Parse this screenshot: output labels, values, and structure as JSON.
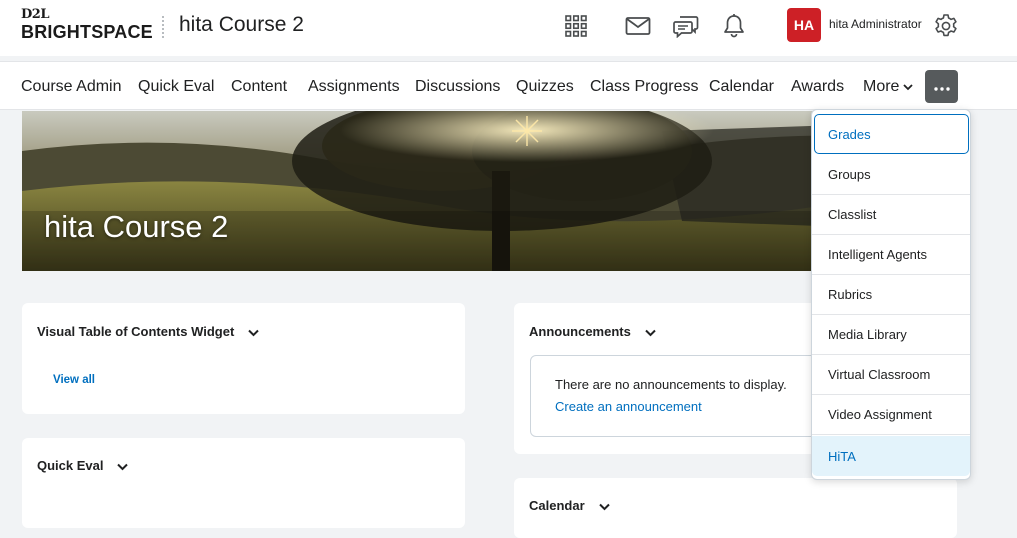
{
  "header": {
    "logo_top": "D2L",
    "logo_bottom": "BRIGHTSPACE",
    "course_title": "hita Course 2",
    "avatar_initials": "HA",
    "user_name": "hita Administrator",
    "avatar_color": "#cd2026"
  },
  "nav": {
    "items": [
      "Course Admin",
      "Quick Eval",
      "Content",
      "Assignments",
      "Discussions",
      "Quizzes",
      "Class Progress",
      "Calendar",
      "Awards"
    ],
    "more_label": "More"
  },
  "banner": {
    "title": "hita Course 2"
  },
  "widgets": {
    "toc": {
      "title": "Visual Table of Contents Widget",
      "link": "View all"
    },
    "quick_eval": {
      "title": "Quick Eval"
    },
    "announcements": {
      "title": "Announcements",
      "empty_text": "There are no announcements to display.",
      "create_link": "Create an announcement"
    },
    "calendar": {
      "title": "Calendar"
    }
  },
  "more_menu": {
    "items": [
      "Grades",
      "Groups",
      "Classlist",
      "Intelligent Agents",
      "Rubrics",
      "Media Library",
      "Virtual Classroom",
      "Video Assignment",
      "HiTA"
    ],
    "focused": "Grades",
    "highlighted": "HiTA"
  },
  "colors": {
    "link": "#006fbf",
    "more_button": "#565a5c",
    "highlight": "#e3f3fb"
  }
}
